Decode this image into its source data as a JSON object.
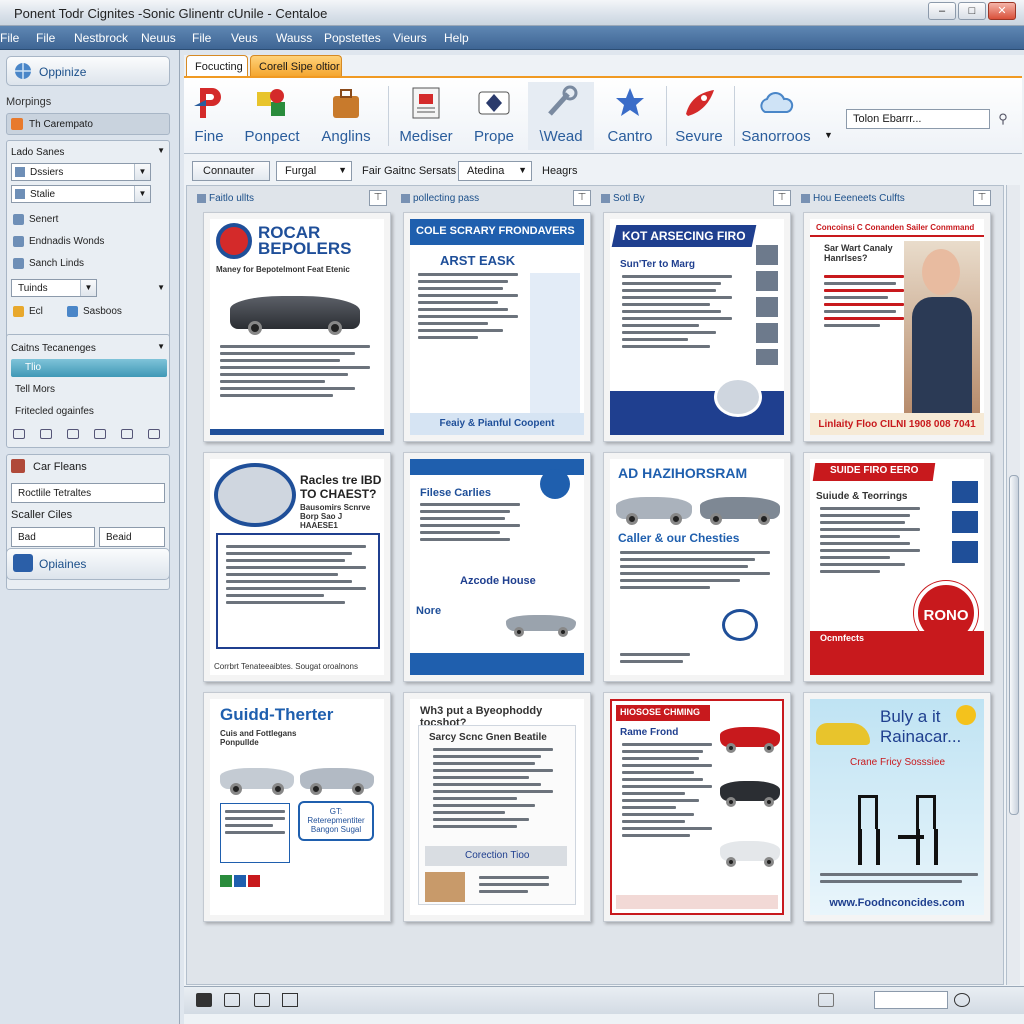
{
  "window": {
    "title": "Ponent Todr Cignites -Sonic Glinentr cUnile - Centaloe",
    "buttons": [
      "–",
      "□",
      "✕"
    ]
  },
  "menu": [
    "File",
    "File",
    "Nestbrock",
    "Neuus",
    "File",
    "Veus",
    "Wauss",
    "Popstettes",
    "Vieurs",
    "Help"
  ],
  "sidebar": {
    "top_button": "Oppinize",
    "section1": "Morpings",
    "current": "Th Carempato",
    "panel1_header": "Lado Sanes",
    "panel1_items": [
      "Dssiers",
      "Stalie",
      "Senert",
      "Endnadis Wonds",
      "Sanch Linds",
      "Tuinds"
    ],
    "panel1_footer": [
      "Ecl",
      "Sasboos"
    ],
    "panel2_header": "Caitns Tecanenges",
    "panel2_selected": "Tlio",
    "panel2_item": "Tell Mors",
    "panel2_item2": "Fritecled ogainfes",
    "car_header": "Car Fleans",
    "templates": "Roctlile Tetraltes",
    "scaller": "Scaller Ciles",
    "btn_bad": "Bad",
    "btn_beaid": "Beaid",
    "bottom_button": "Opiaines"
  },
  "tabs": [
    "Focucting",
    "Corell Sipe oltior"
  ],
  "ribbon": {
    "buttons": [
      "Fine",
      "Ponpect",
      "Anglins",
      "Mediser",
      "Prope",
      "\\Wead",
      "Cantro",
      "Sevure",
      "Sanorroos"
    ],
    "search_placeholder": "Tolon Ebarrr..."
  },
  "filterbar": {
    "button1": "Connauter",
    "select1": "Furgal",
    "label": "Fair Gaitnc Sersats",
    "select2": "Atedina",
    "label2": "Heagrs"
  },
  "columns": [
    "Faitlo ullts",
    "pollecting pass",
    "Sotl By",
    "Hou Eeeneets Culfts"
  ],
  "cards": [
    {
      "title": "ROCAR BEPOLERS",
      "subtitle": "Maney for Bepotelmont Feat Etenic",
      "color": "#1f4f99"
    },
    {
      "title": "COLE SCRARY FRONDAVERS",
      "subtitle": "ARST EASK",
      "footer": "Feaiy & Pianful Coopent",
      "color": "#1f5fae"
    },
    {
      "title": "KOT ARSECING FIRO",
      "subtitle": "Sun'Ter to Marg",
      "color": "#1f3f8f"
    },
    {
      "title": "Concoinsi C Conanden Sailer Conmmand",
      "subtitle": "Sar Wart Canaly Hanrlses?",
      "footer": "Linlaity Floo CILNI 1908 008 7041",
      "color": "#c8191d"
    },
    {
      "title": "Racles tre IBD TO CHAEST?",
      "subtitle": "Bausomirs Scnrve Borp Sao J HAAESE1",
      "footer": "Corrbrt Tenateeaibtes. Sougat oroalnons",
      "color": "#222"
    },
    {
      "title": "Filese Carlies",
      "subtitle": "Azcode House",
      "footer": "Nore",
      "color": "#1f5fae"
    },
    {
      "title": "AD HAZIHORSRAM",
      "subtitle": "Caller & our Chesties",
      "color": "#1f5fae"
    },
    {
      "title": "SUIDE FIRO EERO",
      "subtitle": "Suiude & Teorrings",
      "badge": "RONO",
      "footer": "Ocnnfects",
      "color": "#c8191d"
    },
    {
      "title": "Guidd-Therter",
      "subtitle": "Cuis and Fottlegans Ponpullde",
      "badge": "GT: Reterepmentiter Bangon Sugal",
      "color": "#1f5fae"
    },
    {
      "title": "Wh3 put a Byeophoddy tocshot?",
      "subtitle": "Sarcy Scnc Gnen Beatile",
      "footer": "Corection Tioo",
      "color": "#333"
    },
    {
      "title": "HIOSOSE CHMING",
      "subtitle": "Rame Frond",
      "color": "#c8191d"
    },
    {
      "title": "Buly a it Rainacar...",
      "subtitle": "Crane Fricy Sosssiee",
      "footer": "www.Foodnconcides.com",
      "color": "#1f3f8f"
    }
  ],
  "statusbar": {
    "zoom_label": ""
  }
}
